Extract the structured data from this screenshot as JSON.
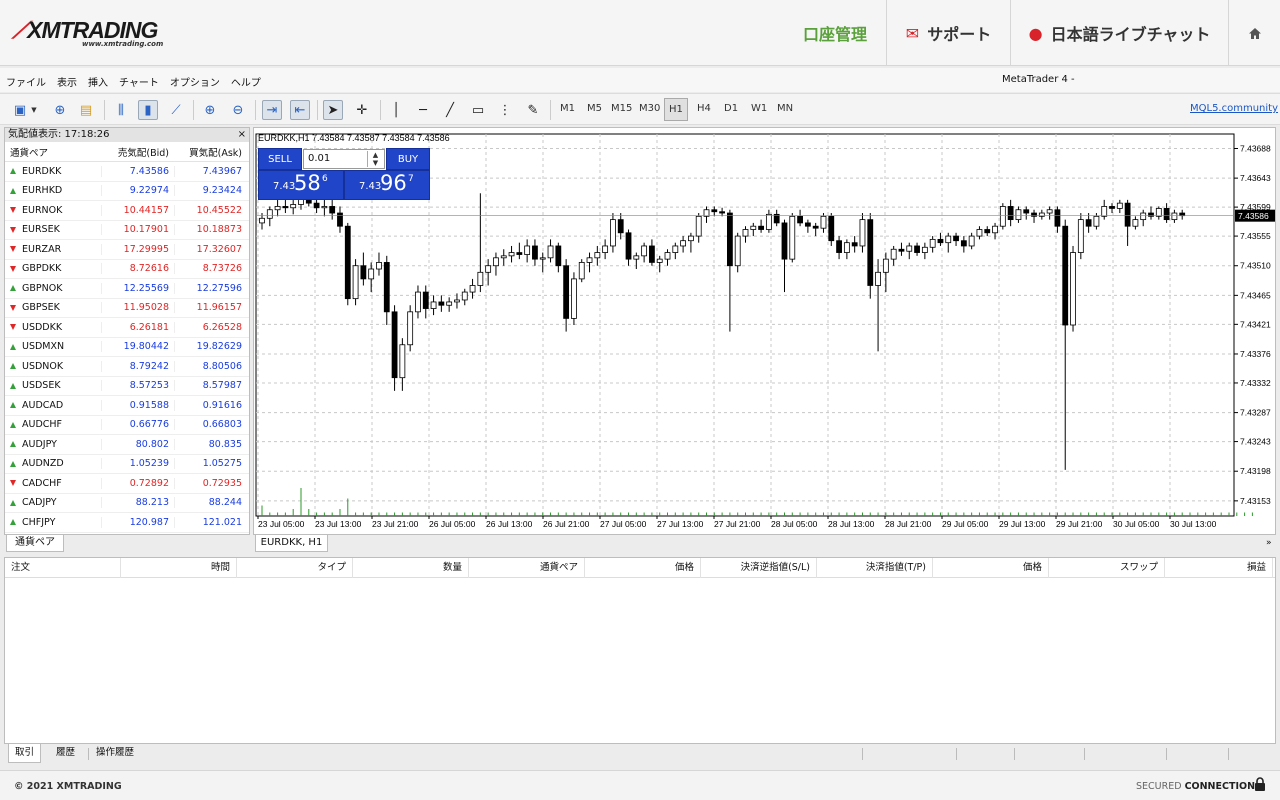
{
  "header": {
    "logo_text": "XMTRADING",
    "logo_sub": "www.xmtrading.com",
    "nav": {
      "account": "口座管理",
      "support": "サポート",
      "chat": "日本語ライブチャット"
    },
    "icons": {
      "support": "envelope-icon",
      "chat": "chat-bubble-icon",
      "home": "home-icon"
    },
    "accent_color": "#5aa13c",
    "brand_red": "#d8232a"
  },
  "menu": {
    "items": [
      "ファイル",
      "表示",
      "挿入",
      "チャート",
      "オプション",
      "ヘルプ"
    ],
    "app_title": "MetaTrader 4 -"
  },
  "toolbar": {
    "timeframes": [
      "M1",
      "M5",
      "M15",
      "M30",
      "H1",
      "H4",
      "D1",
      "W1",
      "MN"
    ],
    "active_timeframe": "H1",
    "mql_link": "MQL5.community"
  },
  "market_watch": {
    "title": "気配値表示: 17:18:26",
    "close": "×",
    "headers": {
      "symbol": "通貨ペア",
      "bid": "売気配(Bid)",
      "ask": "買気配(Ask)"
    },
    "rows": [
      {
        "symbol": "EURDKK",
        "bid": "7.43586",
        "ask": "7.43967",
        "dir": "up",
        "color": "blue"
      },
      {
        "symbol": "EURHKD",
        "bid": "9.22974",
        "ask": "9.23424",
        "dir": "up",
        "color": "blue"
      },
      {
        "symbol": "EURNOK",
        "bid": "10.44157",
        "ask": "10.45522",
        "dir": "dn",
        "color": "red"
      },
      {
        "symbol": "EURSEK",
        "bid": "10.17901",
        "ask": "10.18873",
        "dir": "dn",
        "color": "red"
      },
      {
        "symbol": "EURZAR",
        "bid": "17.29995",
        "ask": "17.32607",
        "dir": "dn",
        "color": "red"
      },
      {
        "symbol": "GBPDKK",
        "bid": "8.72616",
        "ask": "8.73726",
        "dir": "dn",
        "color": "red"
      },
      {
        "symbol": "GBPNOK",
        "bid": "12.25569",
        "ask": "12.27596",
        "dir": "up",
        "color": "blue"
      },
      {
        "symbol": "GBPSEK",
        "bid": "11.95028",
        "ask": "11.96157",
        "dir": "dn",
        "color": "red"
      },
      {
        "symbol": "USDDKK",
        "bid": "6.26181",
        "ask": "6.26528",
        "dir": "dn",
        "color": "red"
      },
      {
        "symbol": "USDMXN",
        "bid": "19.80442",
        "ask": "19.82629",
        "dir": "up",
        "color": "blue"
      },
      {
        "symbol": "USDNOK",
        "bid": "8.79242",
        "ask": "8.80506",
        "dir": "up",
        "color": "blue"
      },
      {
        "symbol": "USDSEK",
        "bid": "8.57253",
        "ask": "8.57987",
        "dir": "up",
        "color": "blue"
      },
      {
        "symbol": "AUDCAD",
        "bid": "0.91588",
        "ask": "0.91616",
        "dir": "up",
        "color": "blue"
      },
      {
        "symbol": "AUDCHF",
        "bid": "0.66776",
        "ask": "0.66803",
        "dir": "up",
        "color": "blue"
      },
      {
        "symbol": "AUDJPY",
        "bid": "80.802",
        "ask": "80.835",
        "dir": "up",
        "color": "blue"
      },
      {
        "symbol": "AUDNZD",
        "bid": "1.05239",
        "ask": "1.05275",
        "dir": "up",
        "color": "blue"
      },
      {
        "symbol": "CADCHF",
        "bid": "0.72892",
        "ask": "0.72935",
        "dir": "dn",
        "color": "red"
      },
      {
        "symbol": "CADJPY",
        "bid": "88.213",
        "ask": "88.244",
        "dir": "up",
        "color": "blue"
      },
      {
        "symbol": "CHFJPY",
        "bid": "120.987",
        "ask": "121.021",
        "dir": "up",
        "color": "blue"
      }
    ],
    "tab": "通貨ペア"
  },
  "chart_window": {
    "header": "EURDKK,H1  7.43584 7.43587 7.43584 7.43586",
    "tab": "EURDKK, H1",
    "more": "»",
    "trade": {
      "sell": "SELL",
      "buy": "BUY",
      "lot": "0.01",
      "sell_pre": "7.43",
      "sell_big": "58",
      "sell_sup": "6",
      "buy_pre": "7.43",
      "buy_big": "96",
      "buy_sup": "7"
    }
  },
  "chart_data": {
    "type": "candlestick",
    "ylim": [
      7.4313,
      7.4371
    ],
    "y_ticks": [
      "7.43688",
      "7.43643",
      "7.43599",
      "7.43555",
      "7.43510",
      "7.43465",
      "7.43421",
      "7.43376",
      "7.43332",
      "7.43287",
      "7.43243",
      "7.43198",
      "7.43153"
    ],
    "current_price": "7.43586",
    "x_ticks": [
      "23 Jul 05:00",
      "23 Jul 13:00",
      "23 Jul 21:00",
      "26 Jul 05:00",
      "26 Jul 13:00",
      "26 Jul 21:00",
      "27 Jul 05:00",
      "27 Jul 13:00",
      "27 Jul 21:00",
      "28 Jul 05:00",
      "28 Jul 13:00",
      "28 Jul 21:00",
      "29 Jul 05:00",
      "29 Jul 13:00",
      "29 Jul 21:00",
      "30 Jul 05:00",
      "30 Jul 13:00"
    ],
    "grid": true,
    "candles": [
      [
        7.43575,
        7.4359,
        7.43565,
        7.43582
      ],
      [
        7.43582,
        7.436,
        7.4357,
        7.43595
      ],
      [
        7.43595,
        7.4361,
        7.43585,
        7.436
      ],
      [
        7.436,
        7.43615,
        7.4359,
        7.43598
      ],
      [
        7.43598,
        7.43612,
        7.43588,
        7.43603
      ],
      [
        7.43603,
        7.43625,
        7.43595,
        7.43617
      ],
      [
        7.43617,
        7.4363,
        7.436,
        7.43605
      ],
      [
        7.43605,
        7.43615,
        7.4359,
        7.43598
      ],
      [
        7.43598,
        7.4362,
        7.43585,
        7.436
      ],
      [
        7.436,
        7.4363,
        7.4358,
        7.4359
      ],
      [
        7.4359,
        7.436,
        7.4356,
        7.4357
      ],
      [
        7.4357,
        7.43575,
        7.4345,
        7.4346
      ],
      [
        7.4346,
        7.4352,
        7.4345,
        7.4351
      ],
      [
        7.4351,
        7.4353,
        7.4348,
        7.4349
      ],
      [
        7.4349,
        7.43515,
        7.4347,
        7.43505
      ],
      [
        7.43505,
        7.4353,
        7.43495,
        7.43515
      ],
      [
        7.43515,
        7.43525,
        7.4342,
        7.4344
      ],
      [
        7.4344,
        7.4345,
        7.4332,
        7.4334
      ],
      [
        7.4334,
        7.434,
        7.4332,
        7.4339
      ],
      [
        7.4339,
        7.4345,
        7.4338,
        7.4344
      ],
      [
        7.4344,
        7.4348,
        7.4343,
        7.4347
      ],
      [
        7.4347,
        7.4348,
        7.4343,
        7.43445
      ],
      [
        7.43445,
        7.43465,
        7.43435,
        7.43455
      ],
      [
        7.43455,
        7.43465,
        7.4344,
        7.4345
      ],
      [
        7.4345,
        7.43462,
        7.4344,
        7.43455
      ],
      [
        7.43455,
        7.43468,
        7.43445,
        7.43458
      ],
      [
        7.43458,
        7.43475,
        7.4345,
        7.4347
      ],
      [
        7.4347,
        7.4349,
        7.4346,
        7.4348
      ],
      [
        7.4348,
        7.4362,
        7.4347,
        7.435
      ],
      [
        7.435,
        7.4352,
        7.4348,
        7.4351
      ],
      [
        7.4351,
        7.4353,
        7.43495,
        7.43522
      ],
      [
        7.43522,
        7.43535,
        7.4351,
        7.43525
      ],
      [
        7.43525,
        7.4354,
        7.43515,
        7.4353
      ],
      [
        7.4353,
        7.43545,
        7.4352,
        7.43527
      ],
      [
        7.43527,
        7.4355,
        7.43515,
        7.4354
      ],
      [
        7.4354,
        7.4355,
        7.4351,
        7.4352
      ],
      [
        7.4352,
        7.4353,
        7.435,
        7.43522
      ],
      [
        7.43522,
        7.4355,
        7.43515,
        7.4354
      ],
      [
        7.4354,
        7.43545,
        7.435,
        7.4351
      ],
      [
        7.4351,
        7.4352,
        7.4341,
        7.4343
      ],
      [
        7.4343,
        7.435,
        7.4342,
        7.4349
      ],
      [
        7.4349,
        7.4352,
        7.43485,
        7.43515
      ],
      [
        7.43515,
        7.4353,
        7.435,
        7.43522
      ],
      [
        7.43522,
        7.4354,
        7.4351,
        7.4353
      ],
      [
        7.4353,
        7.4355,
        7.4352,
        7.4354
      ],
      [
        7.4354,
        7.4359,
        7.4353,
        7.4358
      ],
      [
        7.4358,
        7.4359,
        7.4355,
        7.4356
      ],
      [
        7.4356,
        7.43565,
        7.4351,
        7.4352
      ],
      [
        7.4352,
        7.4353,
        7.43505,
        7.43525
      ],
      [
        7.43525,
        7.43545,
        7.43515,
        7.4354
      ],
      [
        7.4354,
        7.4355,
        7.4351,
        7.43515
      ],
      [
        7.43515,
        7.43525,
        7.435,
        7.4352
      ],
      [
        7.4352,
        7.43535,
        7.4351,
        7.4353
      ],
      [
        7.4353,
        7.43545,
        7.4352,
        7.4354
      ],
      [
        7.4354,
        7.43555,
        7.4353,
        7.43548
      ],
      [
        7.43548,
        7.4356,
        7.4353,
        7.43555
      ],
      [
        7.43555,
        7.4359,
        7.43545,
        7.43585
      ],
      [
        7.43585,
        7.436,
        7.43575,
        7.43595
      ],
      [
        7.43595,
        7.436,
        7.43585,
        7.43592
      ],
      [
        7.43592,
        7.43598,
        7.43585,
        7.4359
      ],
      [
        7.4359,
        7.43595,
        7.4341,
        7.4351
      ],
      [
        7.4351,
        7.4356,
        7.435,
        7.43555
      ],
      [
        7.43555,
        7.4357,
        7.43545,
        7.43565
      ],
      [
        7.43565,
        7.43575,
        7.43555,
        7.4357
      ],
      [
        7.4357,
        7.4358,
        7.4356,
        7.43565
      ],
      [
        7.43565,
        7.43595,
        7.4356,
        7.43588
      ],
      [
        7.43588,
        7.43595,
        7.4357,
        7.43575
      ],
      [
        7.43575,
        7.4358,
        7.4347,
        7.4352
      ],
      [
        7.4352,
        7.4359,
        7.43515,
        7.43585
      ],
      [
        7.43585,
        7.43595,
        7.4357,
        7.43575
      ],
      [
        7.43575,
        7.4358,
        7.4356,
        7.4357
      ],
      [
        7.4357,
        7.43575,
        7.43555,
        7.43567
      ],
      [
        7.43567,
        7.4359,
        7.4356,
        7.43585
      ],
      [
        7.43585,
        7.4359,
        7.4354,
        7.43548
      ],
      [
        7.43548,
        7.43555,
        7.4352,
        7.4353
      ],
      [
        7.4353,
        7.4355,
        7.4352,
        7.43545
      ],
      [
        7.43545,
        7.43555,
        7.4353,
        7.4354
      ],
      [
        7.4354,
        7.4359,
        7.4353,
        7.4358
      ],
      [
        7.4358,
        7.4359,
        7.4346,
        7.4348
      ],
      [
        7.4348,
        7.4352,
        7.4338,
        7.435
      ],
      [
        7.435,
        7.4353,
        7.4347,
        7.4352
      ],
      [
        7.4352,
        7.4354,
        7.4351,
        7.43535
      ],
      [
        7.43535,
        7.43545,
        7.43525,
        7.43532
      ],
      [
        7.43532,
        7.43545,
        7.4352,
        7.4354
      ],
      [
        7.4354,
        7.43545,
        7.43525,
        7.4353
      ],
      [
        7.4353,
        7.43545,
        7.4352,
        7.43538
      ],
      [
        7.43538,
        7.43555,
        7.4353,
        7.4355
      ],
      [
        7.4355,
        7.4356,
        7.4354,
        7.43545
      ],
      [
        7.43545,
        7.4356,
        7.4353,
        7.43555
      ],
      [
        7.43555,
        7.4356,
        7.4354,
        7.43548
      ],
      [
        7.43548,
        7.43555,
        7.4353,
        7.4354
      ],
      [
        7.4354,
        7.4356,
        7.43535,
        7.43555
      ],
      [
        7.43555,
        7.4357,
        7.4355,
        7.43565
      ],
      [
        7.43565,
        7.4357,
        7.43555,
        7.4356
      ],
      [
        7.4356,
        7.43575,
        7.4355,
        7.4357
      ],
      [
        7.4357,
        7.43605,
        7.43565,
        7.436
      ],
      [
        7.436,
        7.4361,
        7.4357,
        7.4358
      ],
      [
        7.4358,
        7.436,
        7.43575,
        7.43595
      ],
      [
        7.43595,
        7.436,
        7.4358,
        7.4359
      ],
      [
        7.4359,
        7.43595,
        7.43575,
        7.43585
      ],
      [
        7.43585,
        7.43595,
        7.4358,
        7.4359
      ],
      [
        7.4359,
        7.436,
        7.4358,
        7.43595
      ],
      [
        7.43595,
        7.436,
        7.4356,
        7.4357
      ],
      [
        7.4357,
        7.4358,
        7.432,
        7.4342
      ],
      [
        7.4342,
        7.4354,
        7.4341,
        7.4353
      ],
      [
        7.4353,
        7.4359,
        7.4352,
        7.4358
      ],
      [
        7.4358,
        7.4359,
        7.4356,
        7.4357
      ],
      [
        7.4357,
        7.4359,
        7.43565,
        7.43585
      ],
      [
        7.43585,
        7.4361,
        7.4358,
        7.436
      ],
      [
        7.436,
        7.43605,
        7.4359,
        7.43597
      ],
      [
        7.43597,
        7.4361,
        7.4359,
        7.43605
      ],
      [
        7.43605,
        7.4361,
        7.4354,
        7.4357
      ],
      [
        7.4357,
        7.43585,
        7.43565,
        7.4358
      ],
      [
        7.4358,
        7.43595,
        7.4357,
        7.4359
      ],
      [
        7.4359,
        7.436,
        7.4358,
        7.43585
      ],
      [
        7.43585,
        7.436,
        7.4358,
        7.43597
      ],
      [
        7.43597,
        7.43605,
        7.43575,
        7.4358
      ],
      [
        7.4358,
        7.43595,
        7.43575,
        7.4359
      ],
      [
        7.4359,
        7.43595,
        7.4358,
        7.43586
      ]
    ],
    "volume": [
      3,
      1,
      1,
      1,
      2,
      8,
      2,
      1,
      1,
      1,
      2,
      5,
      1,
      1,
      1,
      1,
      1,
      1,
      1,
      1,
      1,
      1,
      1,
      1,
      1,
      1,
      1,
      1,
      1,
      1,
      1,
      1,
      1,
      1,
      1,
      1,
      1,
      1,
      1,
      1,
      1,
      1,
      1,
      1,
      1,
      1,
      1,
      1,
      1,
      1,
      1,
      1,
      1,
      1,
      1,
      1,
      1,
      1,
      1,
      1,
      1,
      1,
      1,
      1,
      1,
      1,
      1,
      1,
      1,
      1,
      1,
      1,
      1,
      1,
      1,
      1,
      1,
      1,
      1,
      1,
      1,
      1,
      1,
      1,
      1,
      1,
      1,
      1,
      1,
      1,
      1,
      1,
      1,
      1,
      1,
      1,
      1,
      1,
      1,
      1,
      1,
      1,
      1,
      1,
      1,
      1,
      1,
      1,
      1,
      1,
      1,
      1,
      1,
      1,
      1,
      1,
      1,
      1,
      1,
      1,
      1,
      1,
      1,
      1,
      1,
      1,
      1,
      1
    ]
  },
  "orders": {
    "headers": [
      "注文",
      "時間",
      "タイプ",
      "数量",
      "通貨ペア",
      "価格",
      "決済逆指値(S/L)",
      "決済指値(T/P)",
      "価格",
      "スワップ",
      "損益"
    ],
    "tabs": [
      "取引",
      "履歴",
      "操作履歴"
    ]
  },
  "footer": {
    "copyright": "© 2021 XMTRADING",
    "secured_1": "SECURED ",
    "secured_2": "CONNECTION"
  }
}
